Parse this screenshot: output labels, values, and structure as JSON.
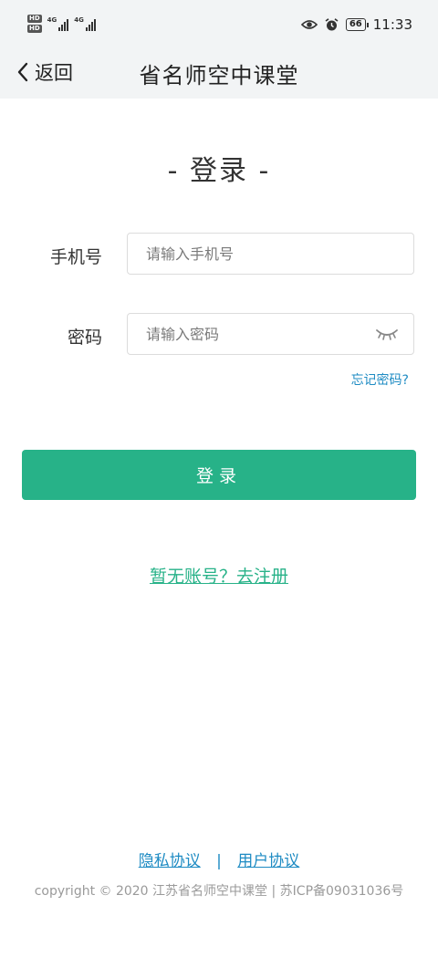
{
  "status_bar": {
    "hd_labels": [
      "HD",
      "HD"
    ],
    "network_labels": [
      "4G",
      "4G"
    ],
    "battery": "66",
    "time": "11:33"
  },
  "nav": {
    "back_label": "返回",
    "title": "省名师空中课堂"
  },
  "form": {
    "heading": "- 登录 -",
    "phone_label": "手机号",
    "phone_placeholder": "请输入手机号",
    "phone_value": "",
    "password_label": "密码",
    "password_placeholder": "请输入密码",
    "password_value": "",
    "forgot_label": "忘记密码?",
    "submit_label": "登录",
    "register_link": "暂无账号？去注册"
  },
  "footer": {
    "privacy_label": "隐私协议",
    "separator": "|",
    "terms_label": "用户协议",
    "copyright": "copyright © 2020 江苏省名师空中课堂 | 苏ICP备09031036号"
  },
  "colors": {
    "accent": "#27b288",
    "link": "#1e8bc3",
    "bar_bg": "#f2f4f5"
  }
}
